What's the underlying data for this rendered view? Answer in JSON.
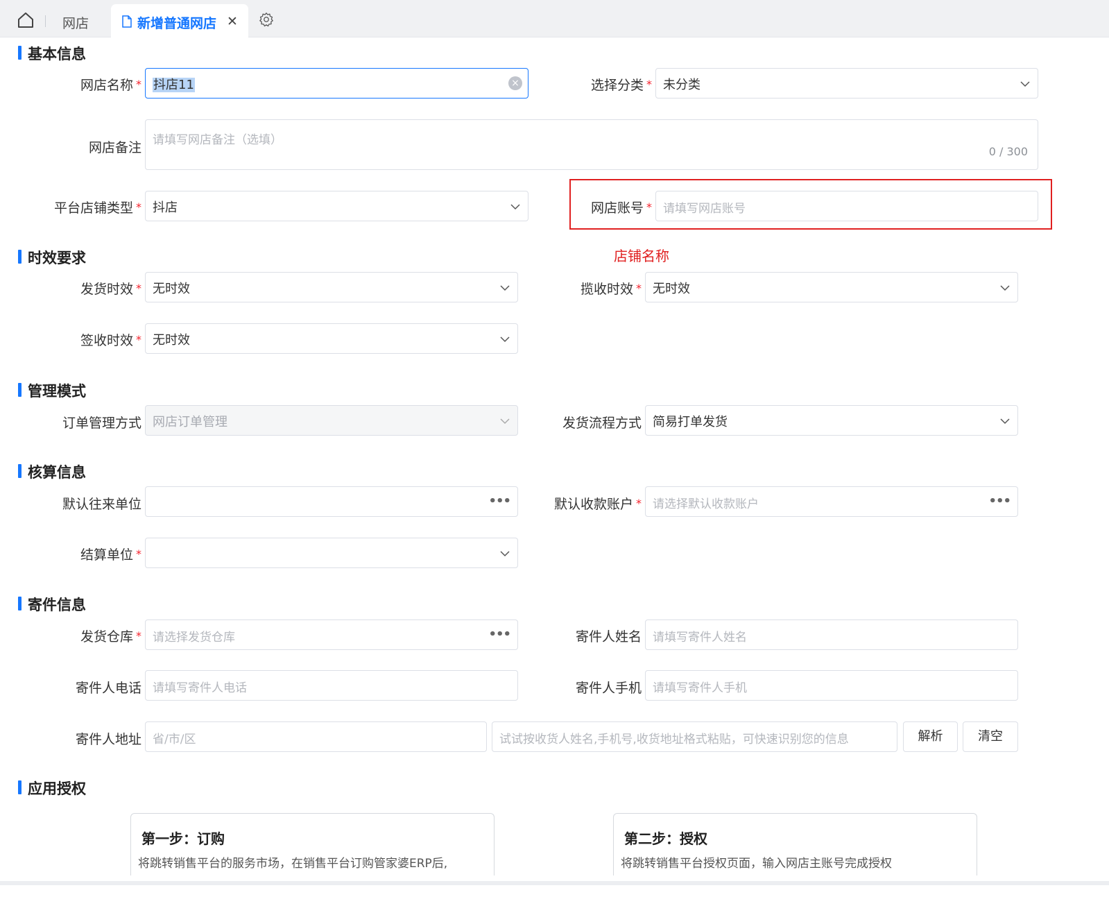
{
  "tabs": {
    "plain_tab": "网店",
    "active_tab": "新增普通网店",
    "close": "✕"
  },
  "sections": {
    "basic": "基本信息",
    "timeliness": "时效要求",
    "management": "管理模式",
    "accounting": "核算信息",
    "sender": "寄件信息",
    "auth": "应用授权"
  },
  "basic": {
    "shop_name_label": "网店名称",
    "shop_name_value": "抖店11",
    "category_label": "选择分类",
    "category_value": "未分类",
    "remark_label": "网店备注",
    "remark_placeholder": "请填写网店备注（选填）",
    "remark_count": "0 / 300",
    "platform_type_label": "平台店铺类型",
    "platform_type_value": "抖店",
    "account_label": "网店账号",
    "account_placeholder": "请填写网店账号",
    "annotation": "店铺名称"
  },
  "timeliness": {
    "ship_label": "发货时效",
    "ship_value": "无时效",
    "pickup_label": "揽收时效",
    "pickup_value": "无时效",
    "sign_label": "签收时效",
    "sign_value": "无时效"
  },
  "management": {
    "order_mode_label": "订单管理方式",
    "order_mode_value": "网店订单管理",
    "ship_flow_label": "发货流程方式",
    "ship_flow_value": "简易打单发货"
  },
  "accounting": {
    "partner_label": "默认往来单位",
    "receipt_label": "默认收款账户",
    "receipt_placeholder": "请选择默认收款账户",
    "settle_label": "结算单位"
  },
  "sender": {
    "warehouse_label": "发货仓库",
    "warehouse_placeholder": "请选择发货仓库",
    "name_label": "寄件人姓名",
    "name_placeholder": "请填写寄件人姓名",
    "phone_label": "寄件人电话",
    "phone_placeholder": "请填写寄件人电话",
    "mobile_label": "寄件人手机",
    "mobile_placeholder": "请填写寄件人手机",
    "address_label": "寄件人地址",
    "region_placeholder": "省/市/区",
    "paste_placeholder": "试试按收货人姓名,手机号,收货地址格式粘贴，可快速识别您的信息",
    "parse_button": "解析",
    "clear_button": "清空"
  },
  "auth": {
    "step1_title": "第一步：订购",
    "step1_desc": "将跳转销售平台的服务市场，在销售平台订购管家婆ERP后,",
    "step2_title": "第二步：授权",
    "step2_desc": "将跳转销售平台授权页面，输入网店主账号完成授权"
  },
  "required_mark": "*",
  "dots": "•••",
  "clear_glyph": "×",
  "colors": {
    "accent": "#1677ff",
    "required": "#f5222d",
    "annotation": "#e02020"
  }
}
